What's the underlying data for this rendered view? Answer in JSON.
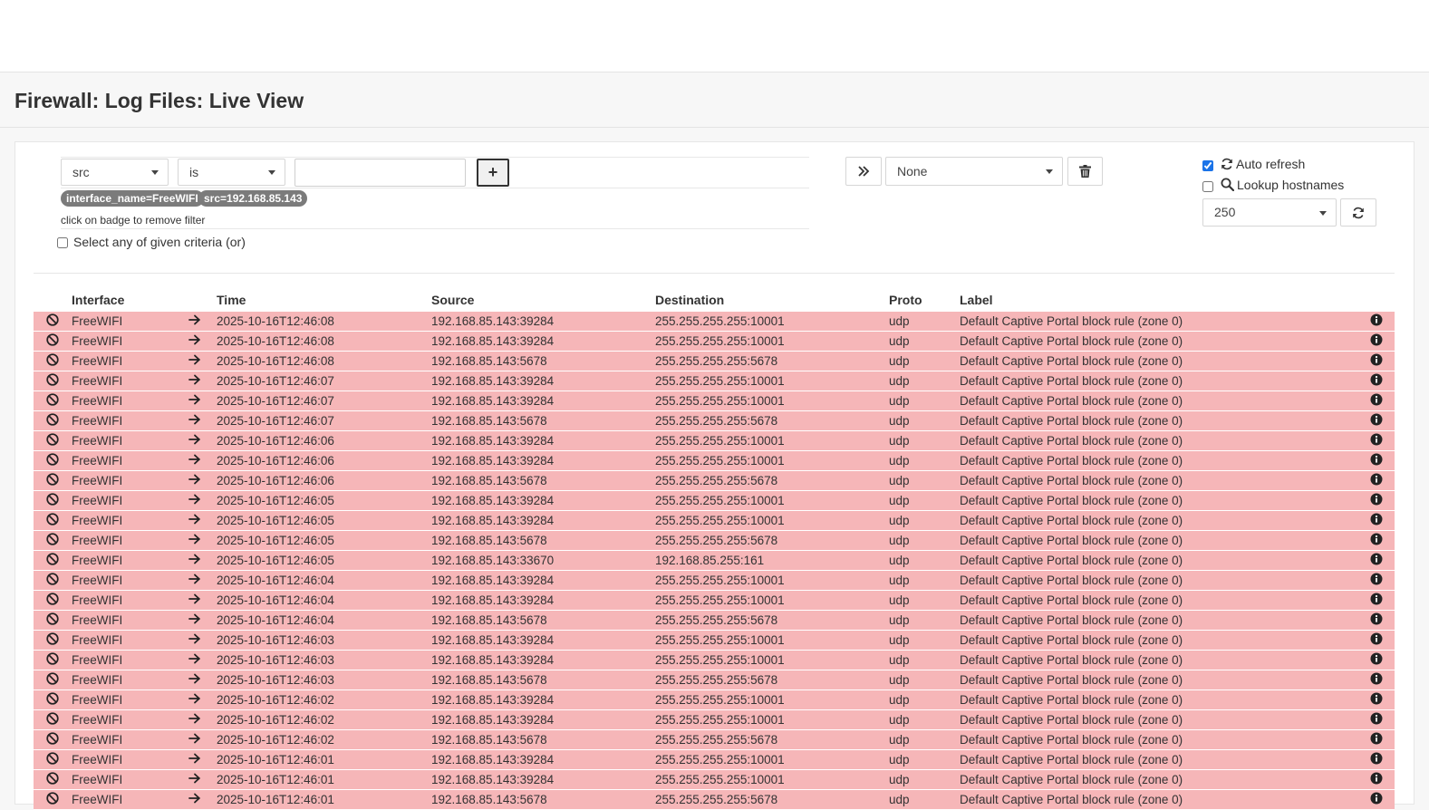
{
  "page": {
    "title": "Firewall: Log Files: Live View"
  },
  "filter": {
    "field_value": "src",
    "operator_value": "is",
    "value_input": "",
    "add_label": "+",
    "badges": [
      "interface_name=FreeWIFI",
      "src=192.168.85.143"
    ],
    "hint": "click on badge to remove filter",
    "or_label": "Select any of given criteria (or)"
  },
  "template": {
    "value": "None"
  },
  "options": {
    "auto_refresh_label": "Auto refresh",
    "auto_refresh_checked": true,
    "lookup_label": "Lookup hostnames",
    "lookup_checked": false,
    "limit_value": "250"
  },
  "colors": {
    "blocked_row": "#f6b6b8",
    "badge": "#7b7b7b",
    "accent": "#1a73e8"
  },
  "table": {
    "columns": [
      "",
      "Interface",
      "",
      "Time",
      "Source",
      "Destination",
      "Proto",
      "Label",
      ""
    ],
    "rows": [
      {
        "interface": "FreeWIFI",
        "time": "2025-10-16T12:46:08",
        "source": "192.168.85.143:39284",
        "destination": "255.255.255.255:10001",
        "proto": "udp",
        "label": "Default Captive Portal block rule (zone 0)"
      },
      {
        "interface": "FreeWIFI",
        "time": "2025-10-16T12:46:08",
        "source": "192.168.85.143:39284",
        "destination": "255.255.255.255:10001",
        "proto": "udp",
        "label": "Default Captive Portal block rule (zone 0)"
      },
      {
        "interface": "FreeWIFI",
        "time": "2025-10-16T12:46:08",
        "source": "192.168.85.143:5678",
        "destination": "255.255.255.255:5678",
        "proto": "udp",
        "label": "Default Captive Portal block rule (zone 0)"
      },
      {
        "interface": "FreeWIFI",
        "time": "2025-10-16T12:46:07",
        "source": "192.168.85.143:39284",
        "destination": "255.255.255.255:10001",
        "proto": "udp",
        "label": "Default Captive Portal block rule (zone 0)"
      },
      {
        "interface": "FreeWIFI",
        "time": "2025-10-16T12:46:07",
        "source": "192.168.85.143:39284",
        "destination": "255.255.255.255:10001",
        "proto": "udp",
        "label": "Default Captive Portal block rule (zone 0)"
      },
      {
        "interface": "FreeWIFI",
        "time": "2025-10-16T12:46:07",
        "source": "192.168.85.143:5678",
        "destination": "255.255.255.255:5678",
        "proto": "udp",
        "label": "Default Captive Portal block rule (zone 0)"
      },
      {
        "interface": "FreeWIFI",
        "time": "2025-10-16T12:46:06",
        "source": "192.168.85.143:39284",
        "destination": "255.255.255.255:10001",
        "proto": "udp",
        "label": "Default Captive Portal block rule (zone 0)"
      },
      {
        "interface": "FreeWIFI",
        "time": "2025-10-16T12:46:06",
        "source": "192.168.85.143:39284",
        "destination": "255.255.255.255:10001",
        "proto": "udp",
        "label": "Default Captive Portal block rule (zone 0)"
      },
      {
        "interface": "FreeWIFI",
        "time": "2025-10-16T12:46:06",
        "source": "192.168.85.143:5678",
        "destination": "255.255.255.255:5678",
        "proto": "udp",
        "label": "Default Captive Portal block rule (zone 0)"
      },
      {
        "interface": "FreeWIFI",
        "time": "2025-10-16T12:46:05",
        "source": "192.168.85.143:39284",
        "destination": "255.255.255.255:10001",
        "proto": "udp",
        "label": "Default Captive Portal block rule (zone 0)"
      },
      {
        "interface": "FreeWIFI",
        "time": "2025-10-16T12:46:05",
        "source": "192.168.85.143:39284",
        "destination": "255.255.255.255:10001",
        "proto": "udp",
        "label": "Default Captive Portal block rule (zone 0)"
      },
      {
        "interface": "FreeWIFI",
        "time": "2025-10-16T12:46:05",
        "source": "192.168.85.143:5678",
        "destination": "255.255.255.255:5678",
        "proto": "udp",
        "label": "Default Captive Portal block rule (zone 0)"
      },
      {
        "interface": "FreeWIFI",
        "time": "2025-10-16T12:46:05",
        "source": "192.168.85.143:33670",
        "destination": "192.168.85.255:161",
        "proto": "udp",
        "label": "Default Captive Portal block rule (zone 0)"
      },
      {
        "interface": "FreeWIFI",
        "time": "2025-10-16T12:46:04",
        "source": "192.168.85.143:39284",
        "destination": "255.255.255.255:10001",
        "proto": "udp",
        "label": "Default Captive Portal block rule (zone 0)"
      },
      {
        "interface": "FreeWIFI",
        "time": "2025-10-16T12:46:04",
        "source": "192.168.85.143:39284",
        "destination": "255.255.255.255:10001",
        "proto": "udp",
        "label": "Default Captive Portal block rule (zone 0)"
      },
      {
        "interface": "FreeWIFI",
        "time": "2025-10-16T12:46:04",
        "source": "192.168.85.143:5678",
        "destination": "255.255.255.255:5678",
        "proto": "udp",
        "label": "Default Captive Portal block rule (zone 0)"
      },
      {
        "interface": "FreeWIFI",
        "time": "2025-10-16T12:46:03",
        "source": "192.168.85.143:39284",
        "destination": "255.255.255.255:10001",
        "proto": "udp",
        "label": "Default Captive Portal block rule (zone 0)"
      },
      {
        "interface": "FreeWIFI",
        "time": "2025-10-16T12:46:03",
        "source": "192.168.85.143:39284",
        "destination": "255.255.255.255:10001",
        "proto": "udp",
        "label": "Default Captive Portal block rule (zone 0)"
      },
      {
        "interface": "FreeWIFI",
        "time": "2025-10-16T12:46:03",
        "source": "192.168.85.143:5678",
        "destination": "255.255.255.255:5678",
        "proto": "udp",
        "label": "Default Captive Portal block rule (zone 0)"
      },
      {
        "interface": "FreeWIFI",
        "time": "2025-10-16T12:46:02",
        "source": "192.168.85.143:39284",
        "destination": "255.255.255.255:10001",
        "proto": "udp",
        "label": "Default Captive Portal block rule (zone 0)"
      },
      {
        "interface": "FreeWIFI",
        "time": "2025-10-16T12:46:02",
        "source": "192.168.85.143:39284",
        "destination": "255.255.255.255:10001",
        "proto": "udp",
        "label": "Default Captive Portal block rule (zone 0)"
      },
      {
        "interface": "FreeWIFI",
        "time": "2025-10-16T12:46:02",
        "source": "192.168.85.143:5678",
        "destination": "255.255.255.255:5678",
        "proto": "udp",
        "label": "Default Captive Portal block rule (zone 0)"
      },
      {
        "interface": "FreeWIFI",
        "time": "2025-10-16T12:46:01",
        "source": "192.168.85.143:39284",
        "destination": "255.255.255.255:10001",
        "proto": "udp",
        "label": "Default Captive Portal block rule (zone 0)"
      },
      {
        "interface": "FreeWIFI",
        "time": "2025-10-16T12:46:01",
        "source": "192.168.85.143:39284",
        "destination": "255.255.255.255:10001",
        "proto": "udp",
        "label": "Default Captive Portal block rule (zone 0)"
      },
      {
        "interface": "FreeWIFI",
        "time": "2025-10-16T12:46:01",
        "source": "192.168.85.143:5678",
        "destination": "255.255.255.255:5678",
        "proto": "udp",
        "label": "Default Captive Portal block rule (zone 0)"
      }
    ]
  }
}
